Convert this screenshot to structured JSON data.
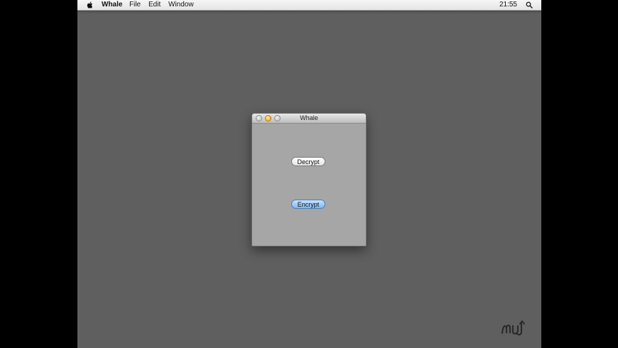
{
  "menubar": {
    "app_name": "Whale",
    "items": [
      "File",
      "Edit",
      "Window"
    ],
    "clock": "21:55",
    "icons": {
      "apple": "apple-icon",
      "spotlight": "spotlight-icon"
    }
  },
  "window": {
    "title": "Whale",
    "controls": [
      "close-button",
      "minimize-button",
      "zoom-button"
    ],
    "buttons": {
      "decrypt_label": "Decrypt",
      "encrypt_label": "Encrypt"
    }
  },
  "colors": {
    "desktop": "#5f5f5f",
    "window_body": "#a6a6a6",
    "encrypt_accent": "#7fb7f2",
    "minimize": "#f0a21a"
  },
  "watermark": {
    "icon": "macupdate-logo-icon"
  }
}
